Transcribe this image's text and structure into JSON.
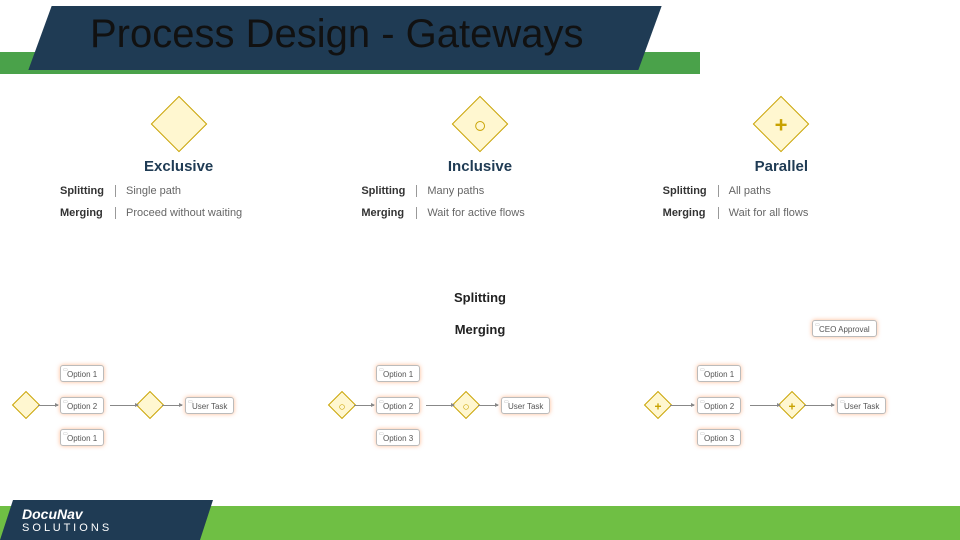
{
  "title": "Process Design - Gateways",
  "labels": {
    "splitting": "Splitting",
    "merging": "Merging"
  },
  "gateways": [
    {
      "name": "Exclusive",
      "mark": "",
      "splitting": "Single path",
      "merging": "Proceed without waiting",
      "diagram_options": [
        "Option 1",
        "Option 2",
        "Option 1"
      ],
      "diagram_endtask": "User Task"
    },
    {
      "name": "Inclusive",
      "mark": "○",
      "splitting": "Many paths",
      "merging": "Wait for active flows",
      "diagram_options": [
        "Option 1",
        "Option 2",
        "Option 3"
      ],
      "diagram_endtask": "User Task"
    },
    {
      "name": "Parallel",
      "mark": "+",
      "splitting": "All paths",
      "merging": "Wait for all flows",
      "diagram_top": "CEO Approval",
      "diagram_options": [
        "Option 1",
        "Option 2",
        "Option 3"
      ],
      "diagram_endtask": "User Task"
    }
  ],
  "brand": {
    "line1": "DocuNav",
    "line2": "S O L U T I O N S"
  }
}
